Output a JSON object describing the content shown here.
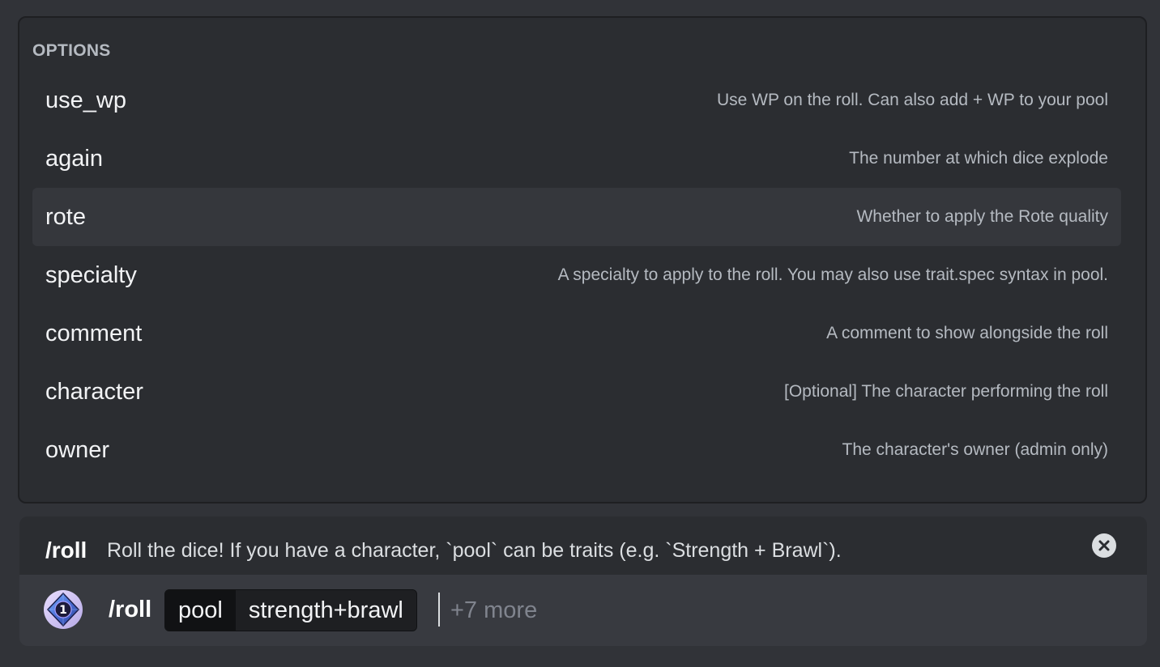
{
  "options_panel": {
    "heading": "OPTIONS",
    "items": [
      {
        "name": "use_wp",
        "description": "Use WP on the roll. Can also add + WP to your pool"
      },
      {
        "name": "again",
        "description": "The number at which dice explode"
      },
      {
        "name": "rote",
        "description": "Whether to apply the Rote quality",
        "selected": true
      },
      {
        "name": "specialty",
        "description": "A specialty to apply to the roll. You may also use trait.spec syntax in pool."
      },
      {
        "name": "comment",
        "description": "A comment to show alongside the roll"
      },
      {
        "name": "character",
        "description": "[Optional] The character performing the roll"
      },
      {
        "name": "owner",
        "description": "The character's owner (admin only)"
      }
    ]
  },
  "command_header": {
    "name": "/roll",
    "description": "Roll the dice! If you have a character, `pool` can be traits (e.g. `Strength + Brawl`)."
  },
  "input": {
    "command": "/roll",
    "param_name": "pool",
    "param_value": "strength+brawl",
    "more_hint": "+7 more",
    "avatar_icon": "d10-die-icon",
    "avatar_digit": "1"
  },
  "colors": {
    "background": "#313338",
    "panel": "#2b2d31",
    "selected_row": "#35373c",
    "input_bar": "#383a40"
  }
}
